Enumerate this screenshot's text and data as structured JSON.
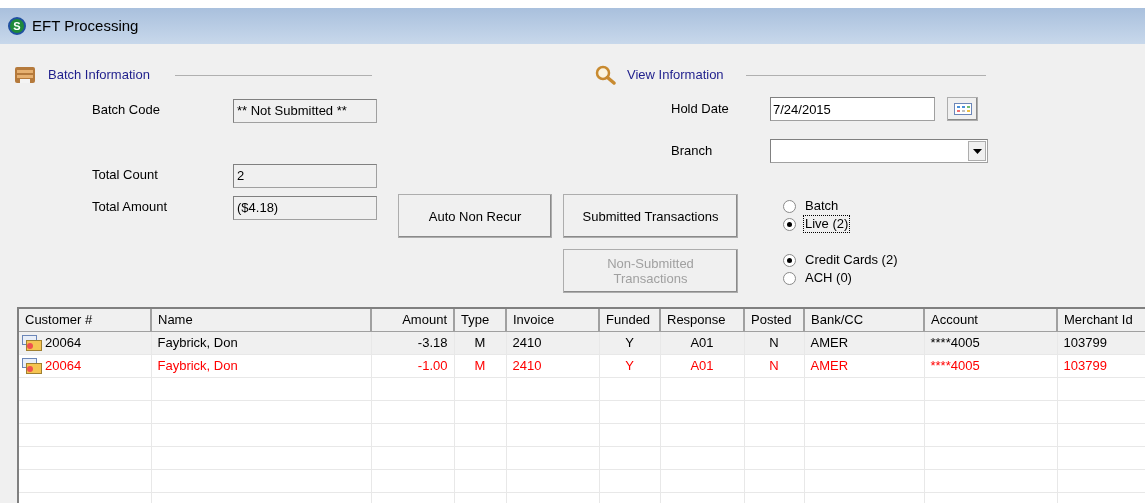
{
  "window": {
    "title": "EFT Processing",
    "icon_letter": "S"
  },
  "batch_information": {
    "heading": "Batch Information",
    "fields": [
      {
        "label": "Batch Code",
        "value": "** Not Submitted **"
      },
      {
        "label": "Total Count",
        "value": "2"
      },
      {
        "label": "Total Amount",
        "value": "($4.18)"
      }
    ]
  },
  "view_information": {
    "heading": "View Information",
    "hold_date": {
      "label": "Hold Date",
      "value": "7/24/2015"
    },
    "branch": {
      "label": "Branch"
    }
  },
  "buttons": [
    {
      "label": "Auto Non Recur",
      "disabled": false
    },
    {
      "label": "Submitted Transactions",
      "disabled": false
    },
    {
      "label": "Non-Submitted Transactions",
      "disabled": true
    }
  ],
  "view_mode": [
    {
      "label": "Batch",
      "selected": false,
      "focused": false
    },
    {
      "label": "Live (2)",
      "selected": true,
      "focused": true
    }
  ],
  "payment_type": [
    {
      "label": "Credit Cards (2)",
      "selected": true,
      "focused": false
    },
    {
      "label": "ACH (0)",
      "selected": false,
      "focused": false
    }
  ],
  "table": {
    "columns": [
      "Customer #",
      "Name",
      "Amount",
      "Type",
      "Invoice",
      "Funded",
      "Response",
      "Posted",
      "Bank/CC",
      "Account",
      "Merchant Id"
    ],
    "rows": [
      {
        "selected": true,
        "color": "#000000",
        "cells": [
          "20064",
          "Faybrick, Don",
          "-3.18",
          "M",
          "2410",
          "Y",
          "A01",
          "N",
          "AMER",
          "****4005",
          "103799"
        ]
      },
      {
        "selected": false,
        "color": "#ff0000",
        "cells": [
          "20064",
          "Faybrick, Don",
          "-1.00",
          "M",
          "2410",
          "Y",
          "A01",
          "N",
          "AMER",
          "****4005",
          "103799"
        ]
      }
    ]
  }
}
